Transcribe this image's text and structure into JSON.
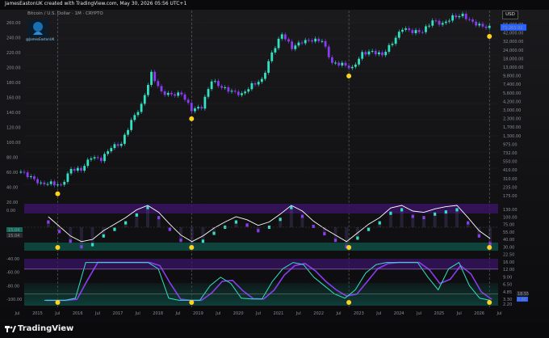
{
  "header": {
    "attribution": "JamesEastonUK created with TradingView.com, May 30, 2026 05:56 UTC+1",
    "symbol": "Bitcoin / U.S. Dollar · 1M · CRYPTO",
    "currency": "USD",
    "logo_text": "@JamesEastonUK"
  },
  "footer": {
    "brand": "TradingView"
  },
  "colors": {
    "background": "#0e0e10",
    "up": "#33e0c1",
    "down": "#8a3cf0",
    "marker": "#ffd21f",
    "overbought_band": "#3a1466",
    "oversold_band": "#0f4a42",
    "envelope": "#ffffff"
  },
  "chart_data": [
    {
      "type": "line",
      "name": "price",
      "scale": "log",
      "x": [
        "2014-09",
        "2014-12",
        "2015-03",
        "2015-06",
        "2015-09",
        "2015-12",
        "2016-03",
        "2016-06",
        "2016-09",
        "2016-12",
        "2017-03",
        "2017-06",
        "2017-09",
        "2017-12",
        "2018-03",
        "2018-06",
        "2018-09",
        "2018-12",
        "2019-03",
        "2019-06",
        "2019-09",
        "2019-12",
        "2020-03",
        "2020-06",
        "2020-09",
        "2020-12",
        "2021-03",
        "2021-06",
        "2021-09",
        "2021-12",
        "2022-03",
        "2022-06",
        "2022-09",
        "2022-12",
        "2023-03",
        "2023-06",
        "2023-09",
        "2023-12",
        "2024-03",
        "2024-06",
        "2024-09",
        "2024-12",
        "2025-03",
        "2025-06",
        "2025-09",
        "2025-12",
        "2026-03",
        "2026-05"
      ],
      "y": [
        390,
        320,
        250,
        260,
        235,
        430,
        420,
        670,
        610,
        960,
        1080,
        2480,
        4350,
        13800,
        6900,
        6400,
        6600,
        3700,
        4100,
        10800,
        8300,
        7200,
        6400,
        9100,
        10800,
        29000,
        58000,
        35000,
        43800,
        46200,
        45500,
        19900,
        19400,
        16500,
        28500,
        30500,
        27000,
        42300,
        71300,
        62700,
        63300,
        93400,
        82500,
        107100,
        114000,
        87500,
        76000,
        73263
      ],
      "y_axis_labels": [
        "56,000.00",
        "42,000.00",
        "32,000.00",
        "24,000.00",
        "18,000.00",
        "13,000.00",
        "9,800.00",
        "7,400.00",
        "5,600.00",
        "4,200.00",
        "3,000.00",
        "2,300.00",
        "1,700.00",
        "1,300.00",
        "975.00",
        "732.00",
        "550.00",
        "410.00",
        "310.00",
        "235.00",
        "175.00"
      ],
      "last_value_label": "73,263.92",
      "oversold_markers": [
        "2015-08",
        "2018-12",
        "2022-11",
        "2026-05"
      ],
      "left_axis_labels": [
        "260.00",
        "240.00",
        "220.00",
        "200.00",
        "180.00",
        "160.00",
        "140.00",
        "120.00",
        "100.00",
        "80.00",
        "60.00",
        "40.00",
        "20.00"
      ]
    },
    {
      "type": "line",
      "name": "oscillator",
      "right_axis_labels": [
        "130.00",
        "100.00",
        "75.00",
        "55.00",
        "40.00",
        "30.00",
        "22.50",
        "16.00",
        "12.00",
        "9.00",
        "6.50",
        "4.85"
      ],
      "left_axis_labels": [
        "0.00"
      ],
      "last_value_labels": [
        "15.04",
        "15.04"
      ],
      "values": [
        0.62,
        0.4,
        0.18,
        0.05,
        0.1,
        0.3,
        0.45,
        0.6,
        0.78,
        0.95,
        0.72,
        0.45,
        0.2,
        0.05,
        0.18,
        0.36,
        0.5,
        0.62,
        0.55,
        0.42,
        0.5,
        0.68,
        0.95,
        0.75,
        0.52,
        0.35,
        0.2,
        0.05,
        0.25,
        0.45,
        0.6,
        0.82,
        0.9,
        0.75,
        0.72,
        0.8,
        0.85,
        0.9,
        0.6,
        0.3,
        0.12
      ]
    },
    {
      "type": "line",
      "name": "stochastic",
      "left_axis_labels": [
        "-40.00",
        "-60.00",
        "-80.00",
        "-100.00"
      ],
      "right_axis_labels": [
        "3.30",
        "2.20"
      ],
      "last_value_labels": [
        "18.55",
        "0.60"
      ],
      "values": [
        5,
        5,
        5,
        10,
        95,
        95,
        95,
        95,
        95,
        95,
        95,
        80,
        10,
        5,
        5,
        5,
        40,
        60,
        45,
        10,
        8,
        8,
        50,
        80,
        95,
        90,
        60,
        40,
        20,
        10,
        30,
        70,
        90,
        95,
        95,
        95,
        95,
        60,
        30,
        80,
        95,
        40,
        10,
        5
      ]
    }
  ],
  "x_axis": {
    "labels": [
      "Jul",
      "2015",
      "Jul",
      "2016",
      "Jul",
      "2017",
      "Jul",
      "2018",
      "Jul",
      "2019",
      "Jul",
      "2020",
      "Jul",
      "2021",
      "Jul",
      "2022",
      "Jul",
      "2023",
      "Jul",
      "2024",
      "Jul",
      "2025",
      "Jul",
      "2026",
      "Jul"
    ]
  }
}
